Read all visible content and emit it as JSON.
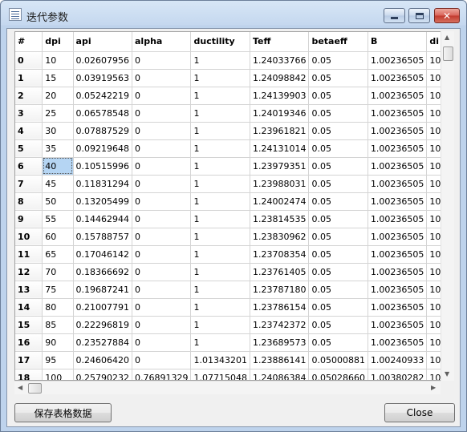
{
  "window": {
    "title": "迭代参数"
  },
  "table": {
    "columns": [
      "#",
      "dpi",
      "api",
      "alpha",
      "ductility",
      "Teff",
      "betaeff",
      "B",
      "di"
    ],
    "rows": [
      [
        "0",
        "10",
        "0.02607956",
        "0",
        "1",
        "1.24033766",
        "0.05",
        "1.00236505",
        "10"
      ],
      [
        "1",
        "15",
        "0.03919563",
        "0",
        "1",
        "1.24098842",
        "0.05",
        "1.00236505",
        "10"
      ],
      [
        "2",
        "20",
        "0.05242219",
        "0",
        "1",
        "1.24139903",
        "0.05",
        "1.00236505",
        "10"
      ],
      [
        "3",
        "25",
        "0.06578548",
        "0",
        "1",
        "1.24019346",
        "0.05",
        "1.00236505",
        "10"
      ],
      [
        "4",
        "30",
        "0.07887529",
        "0",
        "1",
        "1.23961821",
        "0.05",
        "1.00236505",
        "10"
      ],
      [
        "5",
        "35",
        "0.09219648",
        "0",
        "1",
        "1.24131014",
        "0.05",
        "1.00236505",
        "10"
      ],
      [
        "6",
        "40",
        "0.10515996",
        "0",
        "1",
        "1.23979351",
        "0.05",
        "1.00236505",
        "10"
      ],
      [
        "7",
        "45",
        "0.11831294",
        "0",
        "1",
        "1.23988031",
        "0.05",
        "1.00236505",
        "10"
      ],
      [
        "8",
        "50",
        "0.13205499",
        "0",
        "1",
        "1.24002474",
        "0.05",
        "1.00236505",
        "10"
      ],
      [
        "9",
        "55",
        "0.14462944",
        "0",
        "1",
        "1.23814535",
        "0.05",
        "1.00236505",
        "10"
      ],
      [
        "10",
        "60",
        "0.15788757",
        "0",
        "1",
        "1.23830962",
        "0.05",
        "1.00236505",
        "10"
      ],
      [
        "11",
        "65",
        "0.17046142",
        "0",
        "1",
        "1.23708354",
        "0.05",
        "1.00236505",
        "10"
      ],
      [
        "12",
        "70",
        "0.18366692",
        "0",
        "1",
        "1.23761405",
        "0.05",
        "1.00236505",
        "10"
      ],
      [
        "13",
        "75",
        "0.19687241",
        "0",
        "1",
        "1.23787180",
        "0.05",
        "1.00236505",
        "10"
      ],
      [
        "14",
        "80",
        "0.21007791",
        "0",
        "1",
        "1.23786154",
        "0.05",
        "1.00236505",
        "10"
      ],
      [
        "15",
        "85",
        "0.22296819",
        "0",
        "1",
        "1.23742372",
        "0.05",
        "1.00236505",
        "10"
      ],
      [
        "16",
        "90",
        "0.23527884",
        "0",
        "1",
        "1.23689573",
        "0.05",
        "1.00236505",
        "10"
      ],
      [
        "17",
        "95",
        "0.24606420",
        "0",
        "1.01343201",
        "1.23886141",
        "0.05000881",
        "1.00240933",
        "10"
      ],
      [
        "18",
        "100",
        "0.25790232",
        "0.76891329",
        "1.07715048",
        "1.24086384",
        "0.05028660",
        "1.00380282",
        "10"
      ]
    ],
    "selected_cell": {
      "row": 6,
      "col": 1
    }
  },
  "buttons": {
    "save_label": "保存表格数据",
    "close_label": "Close"
  },
  "icons": {
    "app": "table-icon",
    "minimize": "minimize-icon",
    "maximize": "maximize-icon",
    "close": "close-icon"
  },
  "colors": {
    "selection": "#b5d5f3",
    "close_button": "#c2392d"
  }
}
